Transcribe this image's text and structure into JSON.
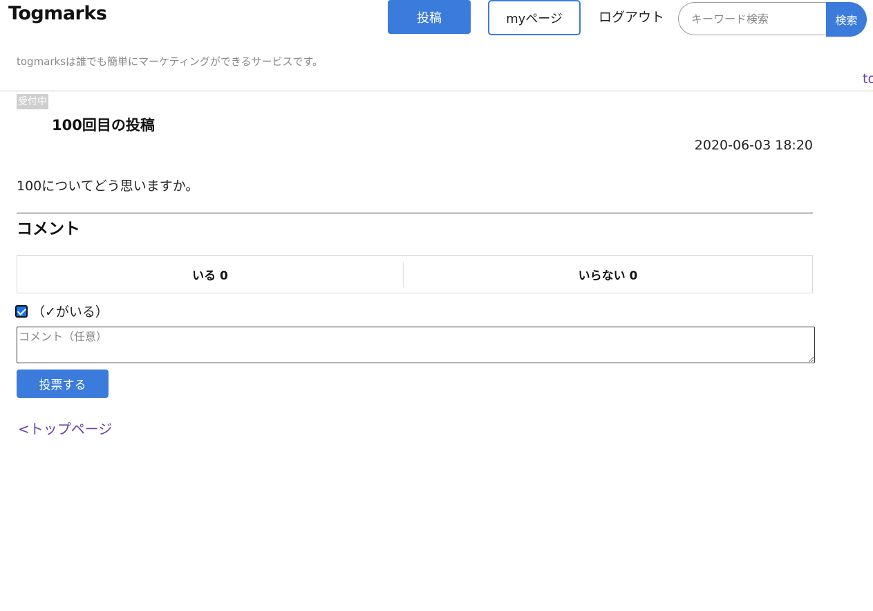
{
  "header": {
    "logo": "Togmarks",
    "post_button": "投稿",
    "mypage_button": "myページ",
    "logout_link": "ログアウト",
    "search_placeholder": "キーワード検索",
    "search_button": "検索",
    "tagline": "togmarksは誰でも簡単にマーケティングができるサービスです。",
    "corner_link": "to"
  },
  "post": {
    "status_badge": "受付中",
    "title": "100回目の投稿",
    "date": "2020-06-03 18:20",
    "body": "100についてどう思いますか。"
  },
  "comments": {
    "section_title": "コメント",
    "vote_yes_label": "いる 0",
    "vote_no_label": "いらない 0",
    "checkbox_label": "（✓がいる）",
    "checkbox_checked": true,
    "comment_placeholder": "コメント（任意）",
    "vote_button": "投票する"
  },
  "footer": {
    "back_link": "<トップページ"
  },
  "colors": {
    "accent": "#3a7bdc",
    "link": "#6a3fa8",
    "badge_bg": "#cfcfcf"
  }
}
